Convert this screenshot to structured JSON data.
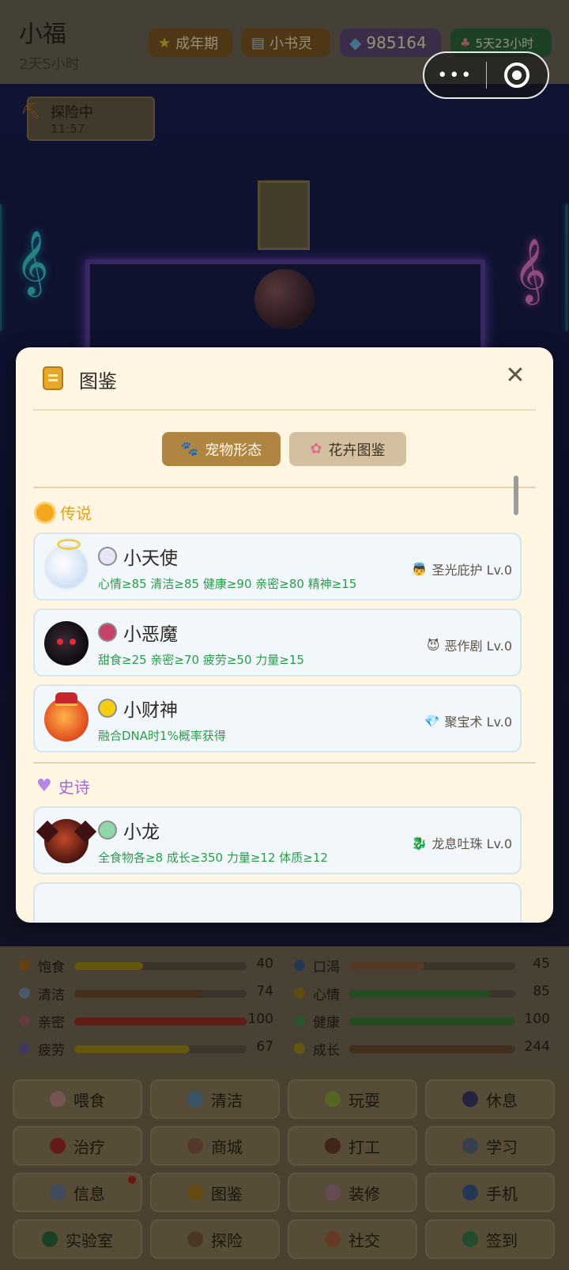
{
  "header": {
    "pet_name": "小福",
    "age": "2天5小时",
    "stage_label": "成年期",
    "role_label": "小书灵",
    "gems": "985164",
    "timer": "5天23小时"
  },
  "scene": {
    "explore_status": "探险中",
    "explore_time": "11:57"
  },
  "modal": {
    "title": "图鉴",
    "close_symbol": "✕",
    "tabs": [
      {
        "label": "宠物形态",
        "active": true,
        "icon": "paw-icon"
      },
      {
        "label": "花卉图鉴",
        "active": false,
        "icon": "flower-icon"
      }
    ],
    "sections": [
      {
        "name": "传说",
        "color": "#e3a219",
        "pets": [
          {
            "name": "小天使",
            "requirement": "心情≥85 清洁≥85 健康≥90 亲密≥80 精神≥15",
            "skill": "圣光庇护 Lv.0",
            "skill_icon": "👼",
            "dot_color": "#e6e6f8"
          },
          {
            "name": "小恶魔",
            "requirement": "甜食≥25 亲密≥70 疲劳≥50 力量≥15",
            "skill": "恶作剧 Lv.0",
            "skill_icon": "😈",
            "dot_color": "#c8416a"
          },
          {
            "name": "小财神",
            "requirement": "融合DNA时1%概率获得",
            "skill": "聚宝术 Lv.0",
            "skill_icon": "💎",
            "dot_color": "#f4cc12"
          }
        ]
      },
      {
        "name": "史诗",
        "color": "#a46bd4",
        "pets": [
          {
            "name": "小龙",
            "requirement": "全食物各≥8 成长≥350 力量≥12 体质≥12",
            "skill": "龙息吐珠 Lv.0",
            "skill_icon": "🐉",
            "dot_color": "#8ed8a8"
          }
        ]
      }
    ]
  },
  "stats": [
    {
      "label": "饱食",
      "value": 40,
      "max": 100,
      "color": "#a48a16",
      "icon_color": "#a4681a"
    },
    {
      "label": "口渴",
      "value": 45,
      "max": 100,
      "color": "#8a5c3c",
      "icon_color": "#3a5a8a"
    },
    {
      "label": "清洁",
      "value": 74,
      "max": 100,
      "color": "#6e4b2e",
      "icon_color": "#7a8ea4"
    },
    {
      "label": "心情",
      "value": 85,
      "max": 100,
      "color": "#3e7a36",
      "icon_color": "#9c7a20"
    },
    {
      "label": "亲密",
      "value": 100,
      "max": 100,
      "color": "#9a3024",
      "icon_color": "#a4606a"
    },
    {
      "label": "健康",
      "value": 100,
      "max": 100,
      "color": "#3e7a36",
      "icon_color": "#4a8a4a"
    },
    {
      "label": "疲劳",
      "value": 67,
      "max": 100,
      "color": "#a48a16",
      "icon_color": "#6a5a9a"
    },
    {
      "label": "成长",
      "value": 244,
      "max": 250,
      "color": "#6e4b2e",
      "icon_color": "#a08a20"
    }
  ],
  "actions": [
    {
      "label": "喂食",
      "icon_color": "#c28a8a"
    },
    {
      "label": "清洁",
      "icon_color": "#5a8aa4"
    },
    {
      "label": "玩耍",
      "icon_color": "#8aa43a"
    },
    {
      "label": "休息",
      "icon_color": "#3a3a6a"
    },
    {
      "label": "治疗",
      "icon_color": "#a42a2a"
    },
    {
      "label": "商城",
      "icon_color": "#8a5a4a"
    },
    {
      "label": "打工",
      "icon_color": "#6a3a2a"
    },
    {
      "label": "学习",
      "icon_color": "#5a6a7a"
    },
    {
      "label": "信息",
      "icon_color": "#6a7a9a",
      "badge": true
    },
    {
      "label": "图鉴",
      "icon_color": "#a47a1a"
    },
    {
      "label": "装修",
      "icon_color": "#a47a8a"
    },
    {
      "label": "手机",
      "icon_color": "#3a5a8a"
    },
    {
      "label": "实验室",
      "icon_color": "#2a6a3a"
    },
    {
      "label": "探险",
      "icon_color": "#7a5a3a"
    },
    {
      "label": "社交",
      "icon_color": "#a4603a"
    },
    {
      "label": "签到",
      "icon_color": "#3a7a4a"
    }
  ]
}
